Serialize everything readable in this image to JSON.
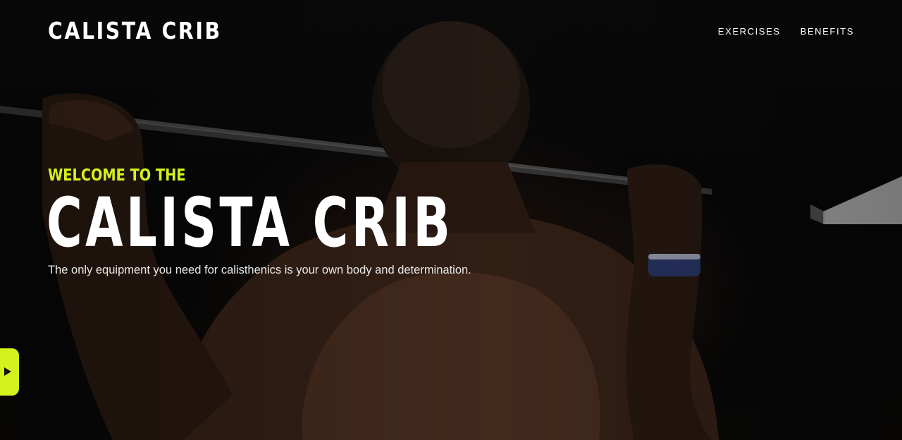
{
  "header": {
    "logo": "CALISTA CRIB",
    "nav": [
      {
        "label": "EXERCISES"
      },
      {
        "label": "BENEFITS"
      }
    ]
  },
  "hero": {
    "eyebrow": "WELCOME TO THE",
    "title": "CALISTA CRIB",
    "tagline": "The only equipment you need for calisthenics is your own body and determination."
  },
  "side_tab": {
    "icon": "play-icon"
  },
  "colors": {
    "accent": "#d4f21c",
    "text": "#ffffff",
    "background": "#050505"
  }
}
